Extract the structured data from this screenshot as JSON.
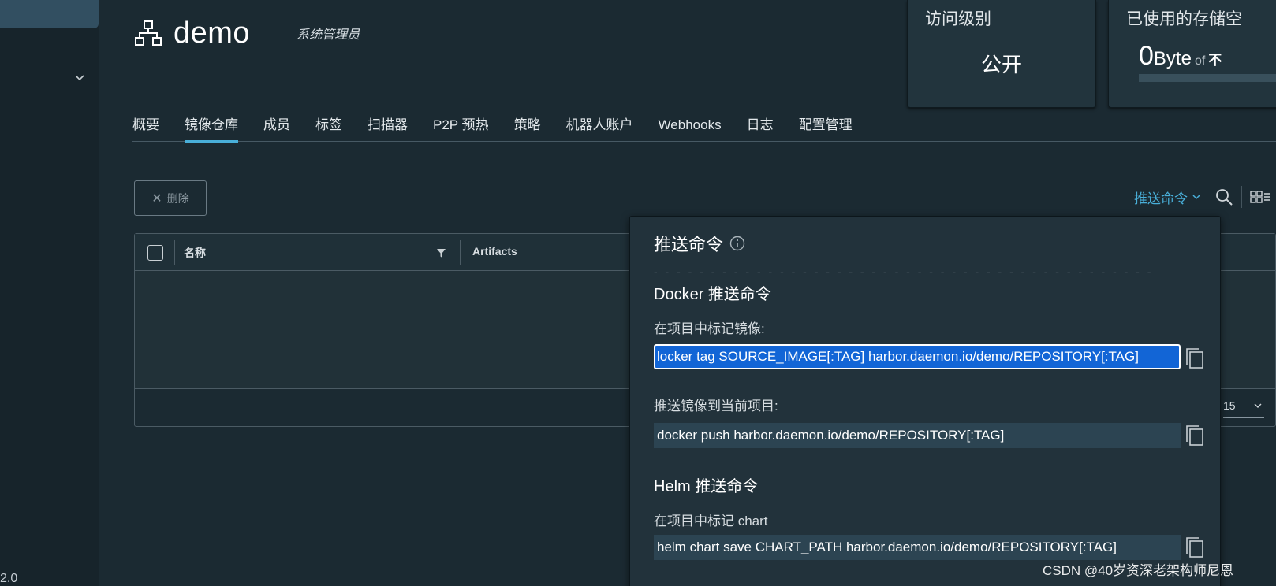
{
  "sidebar": {
    "version": "2.0"
  },
  "header": {
    "project_name": "demo",
    "role": "系统管理员"
  },
  "cards": {
    "access": {
      "title": "访问级别",
      "value": "公开"
    },
    "storage": {
      "title": "已使用的存储空",
      "used_number": "0",
      "used_unit": "Byte",
      "of_label": "of",
      "limit": "不"
    }
  },
  "tabs": [
    {
      "label": "概要"
    },
    {
      "label": "镜像仓库"
    },
    {
      "label": "成员"
    },
    {
      "label": "标签"
    },
    {
      "label": "扫描器"
    },
    {
      "label": "P2P 预热"
    },
    {
      "label": "策略"
    },
    {
      "label": "机器人账户"
    },
    {
      "label": "Webhooks"
    },
    {
      "label": "日志"
    },
    {
      "label": "配置管理"
    }
  ],
  "toolbar": {
    "delete_label": "删除",
    "push_command_label": "推送命令"
  },
  "table": {
    "columns": [
      "名称",
      "Artifacts"
    ],
    "page_size": "15"
  },
  "popover": {
    "title": "推送命令",
    "dashes": "- - - - - - - - - - - - - - - - - - - - - - - - - - - - - - - - - - - - - - - - - - - -",
    "docker_title": "Docker 推送命令",
    "tag_label": "在项目中标记镜像:",
    "tag_cmd": "locker tag SOURCE_IMAGE[:TAG] harbor.daemon.io/demo/REPOSITORY[:TAG]",
    "push_label": "推送镜像到当前项目:",
    "push_cmd": "docker push harbor.daemon.io/demo/REPOSITORY[:TAG]",
    "helm_title": "Helm 推送命令",
    "chart_label": "在项目中标记 chart",
    "chart_cmd": "helm chart save CHART_PATH harbor.daemon.io/demo/REPOSITORY[:TAG]"
  },
  "watermark": "CSDN @40岁资深老架构师尼恩",
  "colors": {
    "accent": "#49afd9",
    "selection": "#1265d6",
    "background": "#1b2a32"
  }
}
